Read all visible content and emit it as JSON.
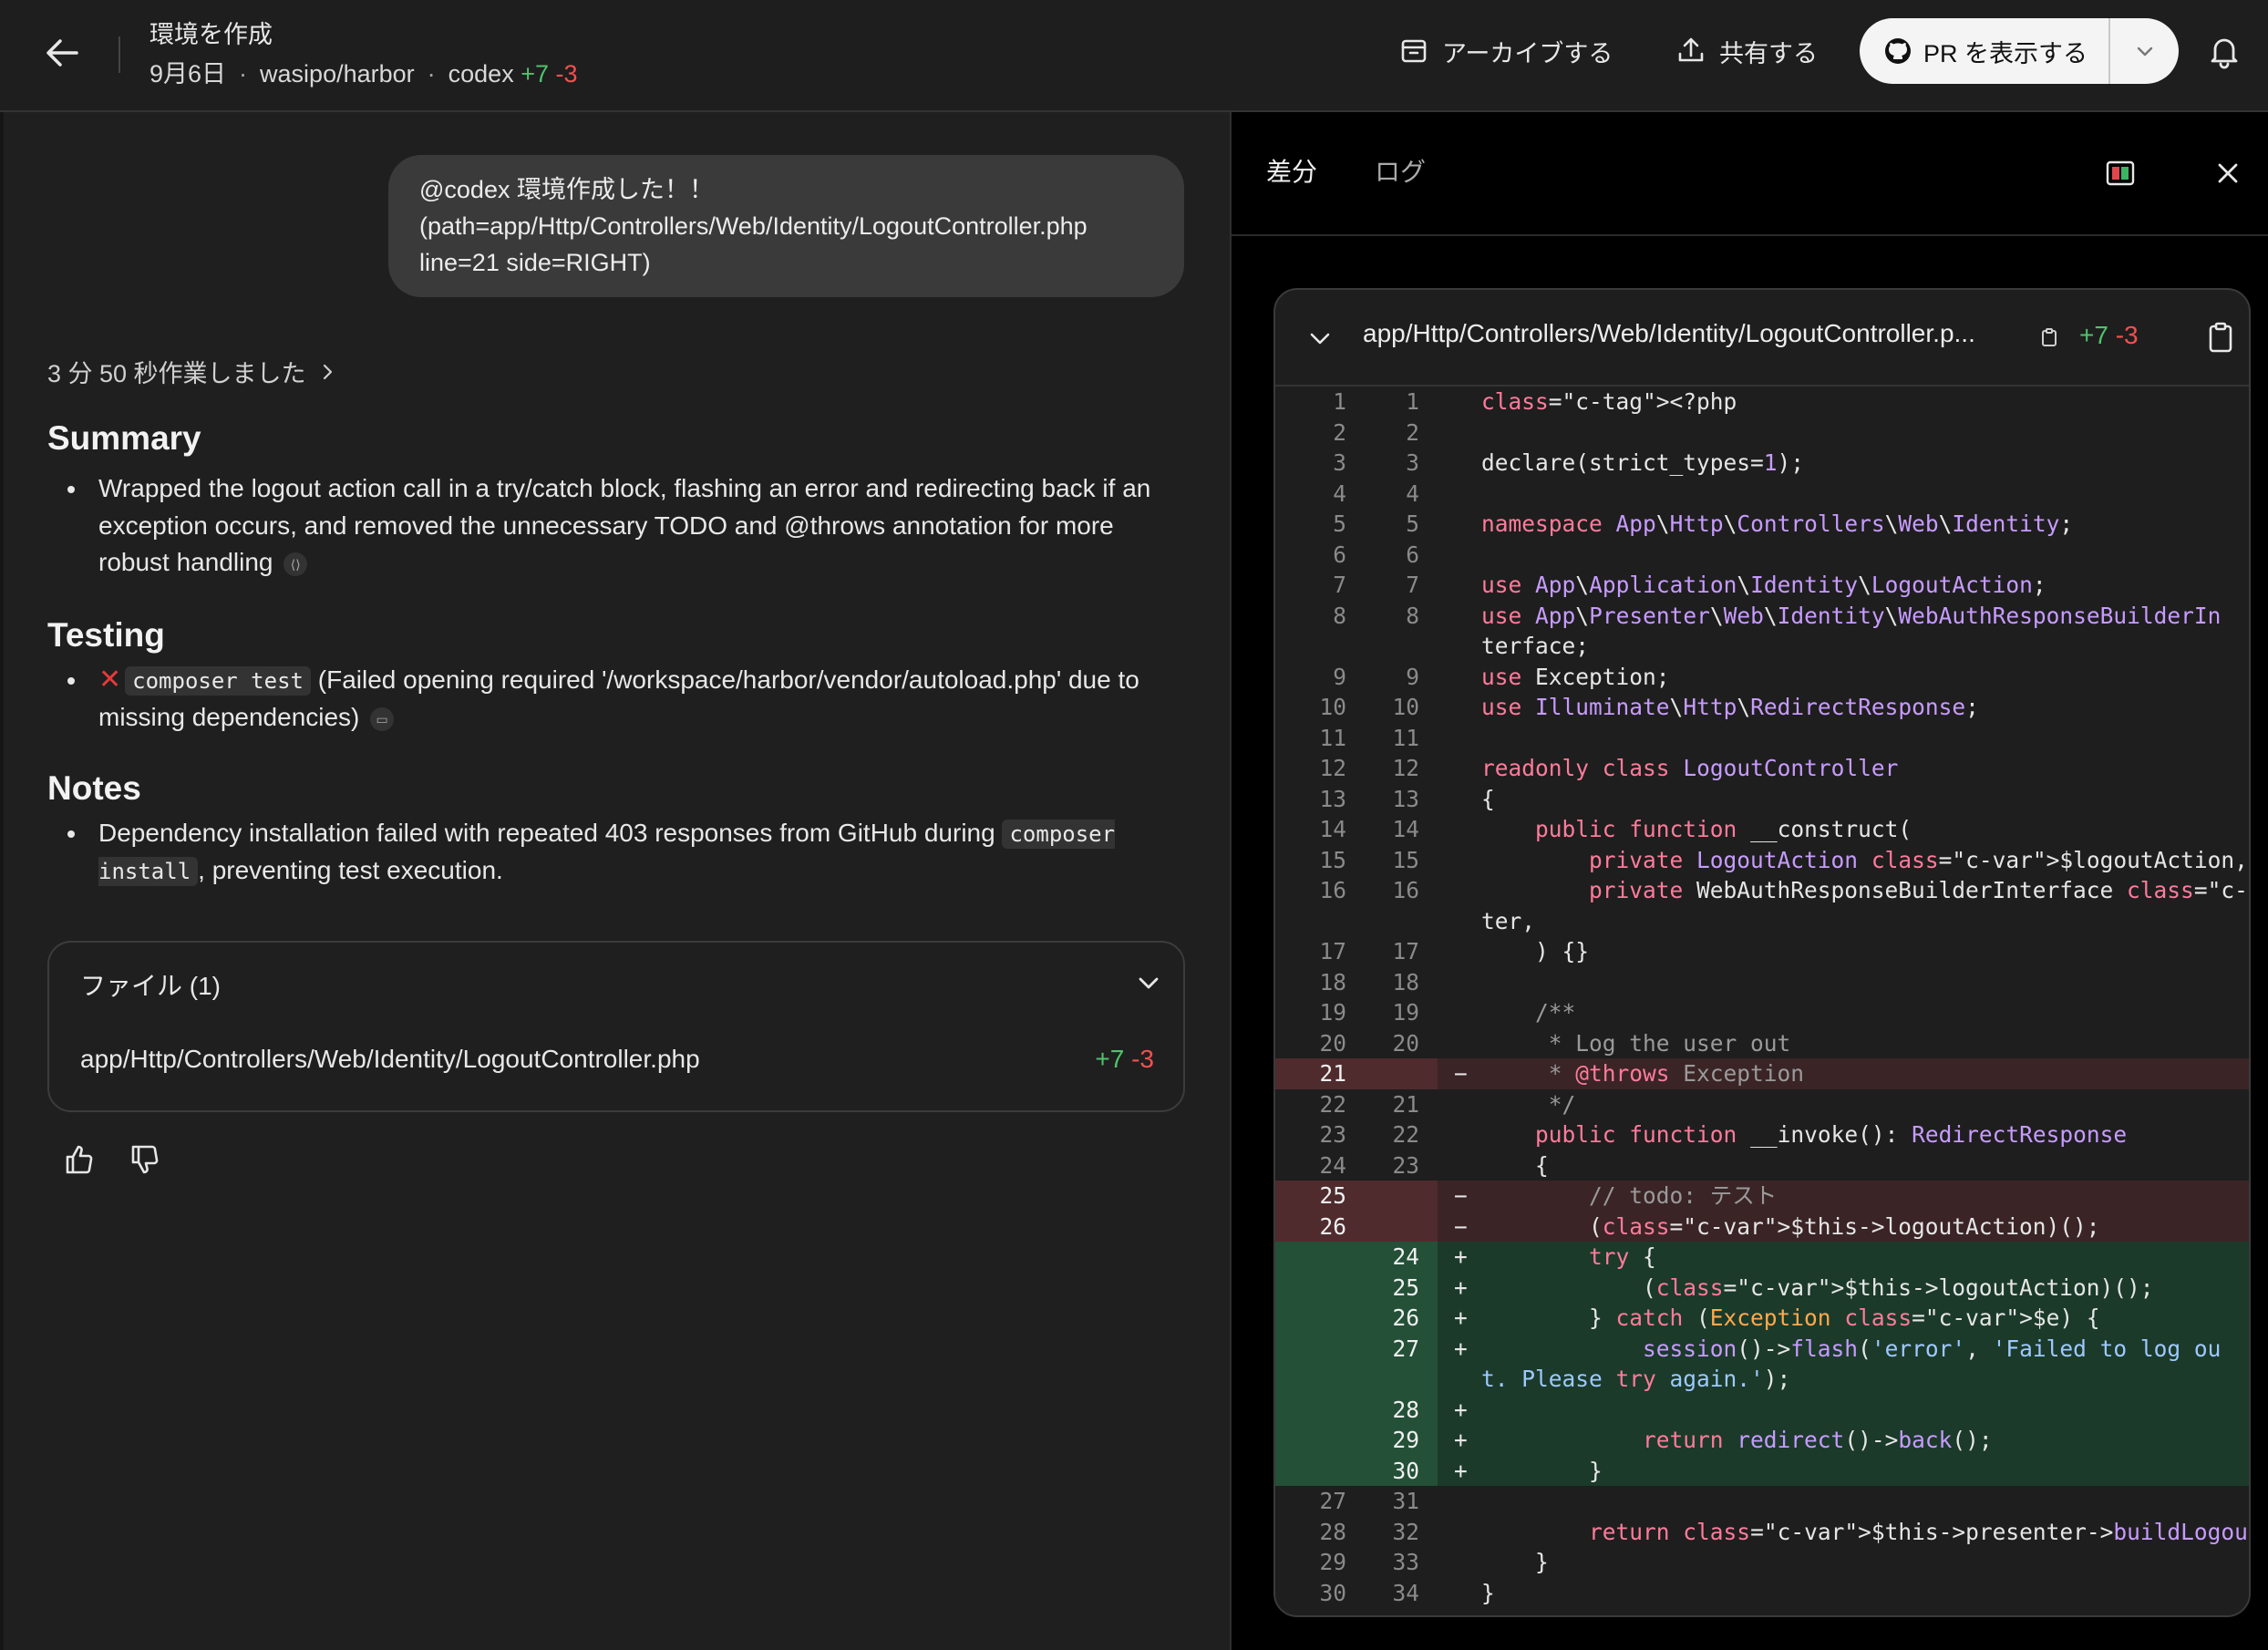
{
  "colors": {
    "added": "#4ec36b",
    "removed": "#f0514f",
    "background": "#1e1e1e"
  },
  "header": {
    "title": "環境を作成",
    "date": "9月6日",
    "repo": "wasipo/harbor",
    "agent": "codex",
    "additions": "+7",
    "deletions": "-3",
    "archive_label": "アーカイブする",
    "share_label": "共有する",
    "pr_label": "PR を表示する"
  },
  "chat": {
    "bubble_lines": [
      "@codex 環境作成した！！",
      "(path=app/Http/Controllers/Web/Identity/LogoutController.php",
      "line=21 side=RIGHT)"
    ],
    "worked_label": "3 分 50 秒作業しました",
    "summary_title": "Summary",
    "summary_item": "Wrapped the logout action call in a try/catch block, flashing an error and redirecting back if an exception occurs, and removed the unnecessary TODO and @throws annotation for more robust handling",
    "testing_title": "Testing",
    "testing_cmd": "composer test",
    "testing_text": " (Failed opening required '/workspace/harbor/vendor/autoload.php' due to missing dependencies)",
    "notes_title": "Notes",
    "notes_text_1": "Dependency installation failed with repeated 403 responses from GitHub during ",
    "notes_cmd": "composer install",
    "notes_text_2": ", preventing test execution."
  },
  "files": {
    "header": "ファイル (1)",
    "items": [
      {
        "path": "app/Http/Controllers/Web/Identity/LogoutController.php",
        "additions": "+7",
        "deletions": "-3"
      }
    ]
  },
  "diff_panel": {
    "tab_diff": "差分",
    "tab_log": "ログ",
    "file_path": "app/Http/Controllers/Web/Identity/LogoutController.p...",
    "additions": "+7",
    "deletions": "-3",
    "lines": [
      {
        "old": "1",
        "new": "1",
        "type": "ctx",
        "code": "<?php"
      },
      {
        "old": "2",
        "new": "2",
        "type": "ctx",
        "code": ""
      },
      {
        "old": "3",
        "new": "3",
        "type": "ctx",
        "code": "declare(strict_types=1);"
      },
      {
        "old": "4",
        "new": "4",
        "type": "ctx",
        "code": ""
      },
      {
        "old": "5",
        "new": "5",
        "type": "ctx",
        "code": "namespace App\\Http\\Controllers\\Web\\Identity;"
      },
      {
        "old": "6",
        "new": "6",
        "type": "ctx",
        "code": ""
      },
      {
        "old": "7",
        "new": "7",
        "type": "ctx",
        "code": "use App\\Application\\Identity\\LogoutAction;"
      },
      {
        "old": "8",
        "new": "8",
        "type": "ctx",
        "code": "use App\\Presenter\\Web\\Identity\\WebAuthResponseBuilderIn"
      },
      {
        "old": "",
        "new": "",
        "type": "wrap",
        "code": "terface;"
      },
      {
        "old": "9",
        "new": "9",
        "type": "ctx",
        "code": "use Exception;"
      },
      {
        "old": "10",
        "new": "10",
        "type": "ctx",
        "code": "use Illuminate\\Http\\RedirectResponse;"
      },
      {
        "old": "11",
        "new": "11",
        "type": "ctx",
        "code": ""
      },
      {
        "old": "12",
        "new": "12",
        "type": "ctx",
        "code": "readonly class LogoutController"
      },
      {
        "old": "13",
        "new": "13",
        "type": "ctx",
        "code": "{"
      },
      {
        "old": "14",
        "new": "14",
        "type": "ctx",
        "code": "    public function __construct("
      },
      {
        "old": "15",
        "new": "15",
        "type": "ctx",
        "code": "        private LogoutAction $logoutAction,"
      },
      {
        "old": "16",
        "new": "16",
        "type": "ctx",
        "code": "        private WebAuthResponseBuilderInterface $presen"
      },
      {
        "old": "",
        "new": "",
        "type": "wrap",
        "code": "ter,"
      },
      {
        "old": "17",
        "new": "17",
        "type": "ctx",
        "code": "    ) {}"
      },
      {
        "old": "18",
        "new": "18",
        "type": "ctx",
        "code": ""
      },
      {
        "old": "19",
        "new": "19",
        "type": "ctx",
        "code": "    /**"
      },
      {
        "old": "20",
        "new": "20",
        "type": "ctx",
        "code": "     * Log the user out"
      },
      {
        "old": "21",
        "new": "",
        "type": "del",
        "code": "     * @throws Exception"
      },
      {
        "old": "22",
        "new": "21",
        "type": "ctx",
        "code": "     */"
      },
      {
        "old": "23",
        "new": "22",
        "type": "ctx",
        "code": "    public function __invoke(): RedirectResponse"
      },
      {
        "old": "24",
        "new": "23",
        "type": "ctx",
        "code": "    {"
      },
      {
        "old": "25",
        "new": "",
        "type": "del",
        "code": "        // todo: テスト"
      },
      {
        "old": "26",
        "new": "",
        "type": "del",
        "code": "        ($this->logoutAction)();"
      },
      {
        "old": "",
        "new": "24",
        "type": "add",
        "code": "        try {"
      },
      {
        "old": "",
        "new": "25",
        "type": "add",
        "code": "            ($this->logoutAction)();"
      },
      {
        "old": "",
        "new": "26",
        "type": "add",
        "code": "        } catch (Exception $e) {"
      },
      {
        "old": "",
        "new": "27",
        "type": "add",
        "code": "            session()->flash('error', 'Failed to log ou"
      },
      {
        "old": "",
        "new": "",
        "type": "addwrap",
        "code": "t. Please try again.');"
      },
      {
        "old": "",
        "new": "28",
        "type": "add",
        "code": ""
      },
      {
        "old": "",
        "new": "29",
        "type": "add",
        "code": "            return redirect()->back();"
      },
      {
        "old": "",
        "new": "30",
        "type": "add",
        "code": "        }"
      },
      {
        "old": "27",
        "new": "31",
        "type": "ctx",
        "code": ""
      },
      {
        "old": "28",
        "new": "32",
        "type": "ctx",
        "code": "        return $this->presenter->buildLogoutResponse();"
      },
      {
        "old": "29",
        "new": "33",
        "type": "ctx",
        "code": "    }"
      },
      {
        "old": "30",
        "new": "34",
        "type": "ctx",
        "code": "}"
      }
    ]
  }
}
